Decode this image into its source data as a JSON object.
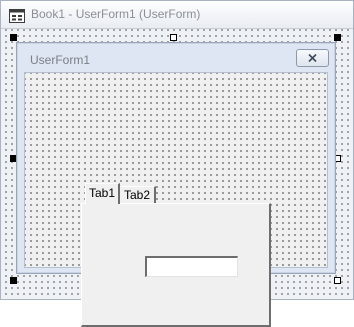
{
  "window": {
    "title": "Book1 - UserForm1 (UserForm)"
  },
  "userform": {
    "caption": "UserForm1"
  },
  "multipage": {
    "tabs": [
      {
        "label": "Tab1",
        "selected": true
      },
      {
        "label": "Tab2",
        "selected": false
      }
    ]
  },
  "textbox": {
    "value": ""
  },
  "icons": {
    "window": "userform-designer-icon",
    "close": "close-icon"
  }
}
